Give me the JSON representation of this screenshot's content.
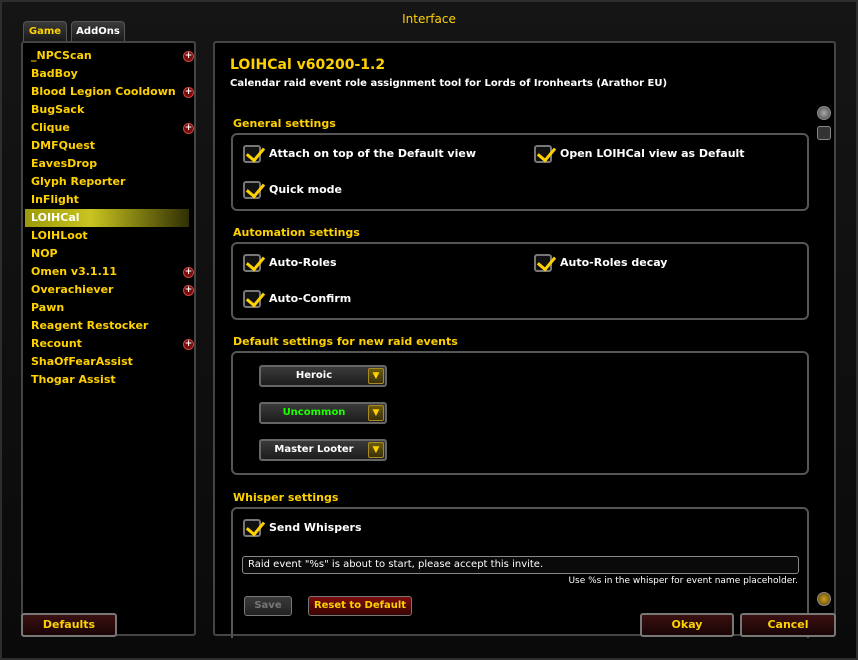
{
  "window": {
    "title": "Interface"
  },
  "tabs": {
    "game": "Game",
    "addons": "AddOns"
  },
  "addons": [
    {
      "name": "_NPCScan",
      "expand": true
    },
    {
      "name": "BadBoy",
      "expand": false
    },
    {
      "name": "Blood Legion Cooldown",
      "expand": true
    },
    {
      "name": "BugSack",
      "expand": false
    },
    {
      "name": "Clique",
      "expand": true
    },
    {
      "name": "DMFQuest",
      "expand": false
    },
    {
      "name": "EavesDrop",
      "expand": false
    },
    {
      "name": "Glyph Reporter",
      "expand": false
    },
    {
      "name": "InFlight",
      "expand": false
    },
    {
      "name": "LOIHCal",
      "expand": false,
      "selected": true
    },
    {
      "name": "LOIHLoot",
      "expand": false
    },
    {
      "name": "NOP",
      "expand": false
    },
    {
      "name": "Omen v3.1.11",
      "expand": true
    },
    {
      "name": "Overachiever",
      "expand": true
    },
    {
      "name": "Pawn",
      "expand": false
    },
    {
      "name": "Reagent Restocker",
      "expand": false
    },
    {
      "name": "Recount",
      "expand": true
    },
    {
      "name": "ShaOfFearAssist",
      "expand": false
    },
    {
      "name": "Thogar Assist",
      "expand": false
    }
  ],
  "panel": {
    "title": "LOIHCal v60200-1.2",
    "description": "Calendar raid event role assignment tool for Lords of Ironhearts (Arathor EU)",
    "general": {
      "heading": "General settings",
      "attach": "Attach on top of the Default view",
      "open_default": "Open LOIHCal view as Default",
      "quick": "Quick mode"
    },
    "automation": {
      "heading": "Automation settings",
      "auto_roles": "Auto-Roles",
      "auto_decay": "Auto-Roles decay",
      "auto_confirm": "Auto-Confirm"
    },
    "defaults": {
      "heading": "Default settings for new raid events",
      "difficulty": "Heroic",
      "quality": "Uncommon",
      "loot": "Master Looter"
    },
    "whisper": {
      "heading": "Whisper settings",
      "send": "Send Whispers",
      "message": "Raid event \"%s\" is about to start, please accept this invite.",
      "hint": "Use %s in the whisper for event name placeholder.",
      "save": "Save",
      "reset": "Reset to Default"
    }
  },
  "footer": {
    "defaults": "Defaults",
    "okay": "Okay",
    "cancel": "Cancel"
  },
  "colors": {
    "gold": "#ffd100",
    "uncommon": "#1eff00",
    "reset_text": "#ffd100"
  }
}
